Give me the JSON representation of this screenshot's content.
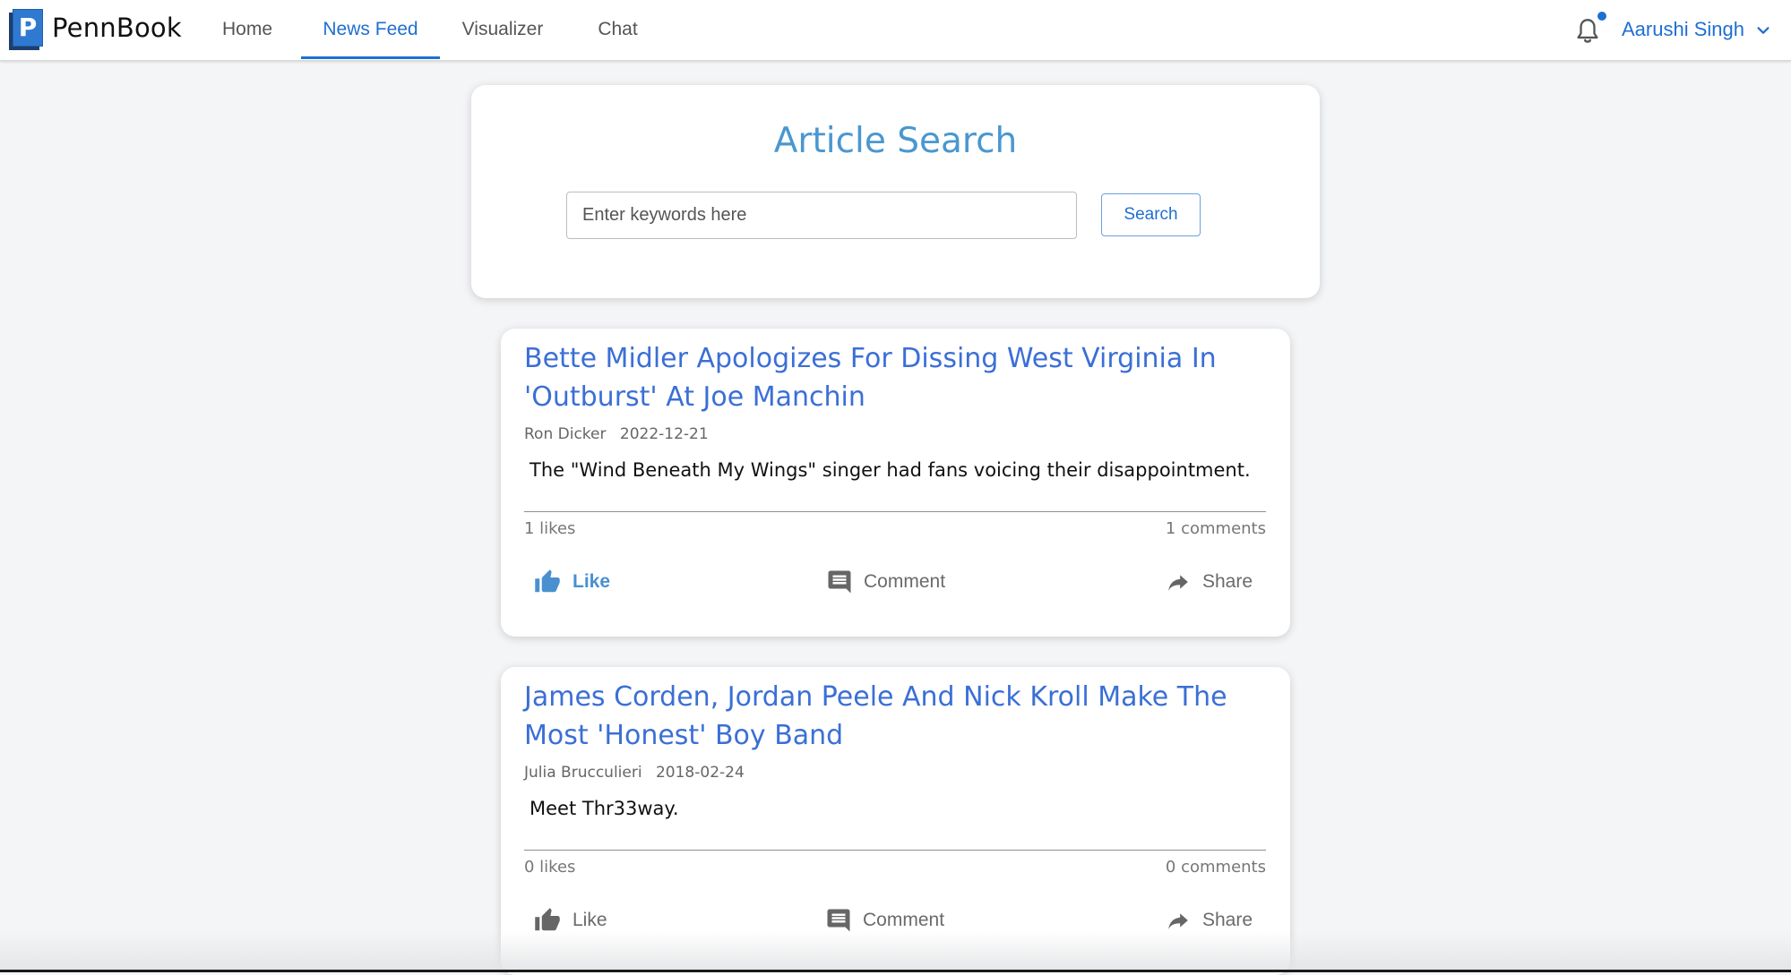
{
  "app": {
    "brand": "PennBook",
    "logo_letter": "P"
  },
  "nav": {
    "tabs": [
      {
        "label": "Home",
        "active": false
      },
      {
        "label": "News Feed",
        "active": true
      },
      {
        "label": "Visualizer",
        "active": false
      },
      {
        "label": "Chat",
        "active": false
      }
    ],
    "user_name": "Aarushi Singh",
    "has_notification": true
  },
  "search": {
    "title": "Article Search",
    "placeholder": "Enter keywords here",
    "value": "",
    "button_label": "Search"
  },
  "articles": [
    {
      "title": "Bette Midler Apologizes For Dissing West Virginia In 'Outburst' At Joe Manchin",
      "author": "Ron Dicker",
      "date": "2022-12-21",
      "description": "The \"Wind Beneath My Wings\" singer had fans voicing their disappointment.",
      "likes_text": "1 likes",
      "comments_text": "1 comments",
      "liked": true,
      "actions": {
        "like": "Like",
        "comment": "Comment",
        "share": "Share"
      }
    },
    {
      "title": "James Corden, Jordan Peele And Nick Kroll Make The Most 'Honest' Boy Band",
      "author": "Julia Brucculieri",
      "date": "2018-02-24",
      "description": "Meet Thr33way.",
      "likes_text": "0 likes",
      "comments_text": "0 comments",
      "liked": false,
      "actions": {
        "like": "Like",
        "comment": "Comment",
        "share": "Share"
      }
    }
  ],
  "colors": {
    "accent": "#1f6fd1",
    "title_blue": "#3b6fd6",
    "search_title": "#4a97d0",
    "liked": "#4a90d0",
    "background": "#f4f5f7"
  }
}
